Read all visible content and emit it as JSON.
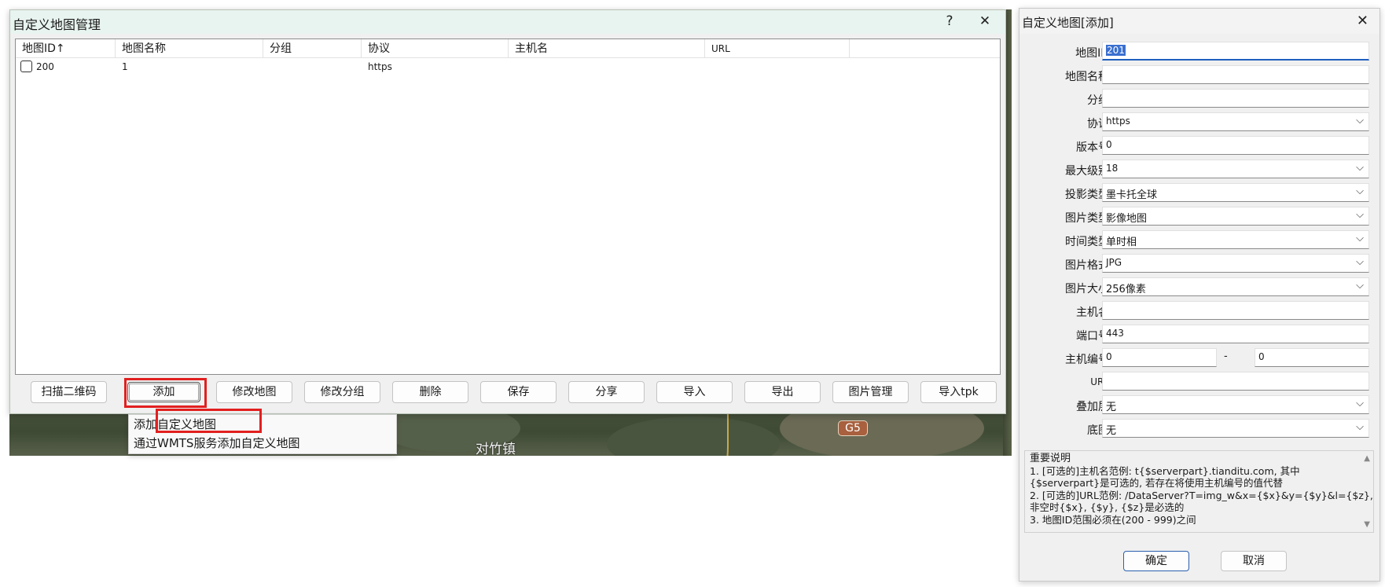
{
  "main_dialog": {
    "title": "自定义地图管理",
    "help_label": "?",
    "close_label": "✕",
    "columns": [
      "地图ID↑",
      "地图名称",
      "分组",
      "协议",
      "主机名",
      "URL"
    ],
    "rows": [
      {
        "id": "200",
        "name": "1",
        "group": "",
        "protocol": "https",
        "host": "",
        "url": ""
      }
    ],
    "buttons": {
      "scan_qr": "扫描二维码",
      "add": "添加",
      "edit_map": "修改地图",
      "edit_group": "修改分组",
      "delete": "删除",
      "save": "保存",
      "share": "分享",
      "import": "导入",
      "export": "导出",
      "image_manage": "图片管理",
      "import_tpk": "导入tpk"
    }
  },
  "add_menu": {
    "items": [
      "添加自定义地图",
      "通过WMTS服务添加自定义地图"
    ]
  },
  "map_background": {
    "labels": [
      "对竹镇",
      "G5"
    ]
  },
  "add_dialog": {
    "title": "自定义地图[添加]",
    "close_label": "✕",
    "fields": {
      "map_id": {
        "label": "地图ID",
        "value": "201"
      },
      "map_name": {
        "label": "地图名称",
        "value": ""
      },
      "group": {
        "label": "分组",
        "value": ""
      },
      "protocol": {
        "label": "协议",
        "value": "https"
      },
      "version": {
        "label": "版本号",
        "value": "0"
      },
      "max_level": {
        "label": "最大级别",
        "value": "18"
      },
      "projection": {
        "label": "投影类型",
        "value": "墨卡托全球"
      },
      "image_type": {
        "label": "图片类型",
        "value": "影像地图"
      },
      "time_type": {
        "label": "时间类型",
        "value": "单时相"
      },
      "image_format": {
        "label": "图片格式",
        "value": "JPG"
      },
      "image_size": {
        "label": "图片大小",
        "value": "256像素"
      },
      "host": {
        "label": "主机名",
        "value": ""
      },
      "port": {
        "label": "端口号",
        "value": "443"
      },
      "host_number": {
        "label": "主机编号",
        "from": "0",
        "separator": "-",
        "to": "0"
      },
      "url": {
        "label": "URL",
        "value": ""
      },
      "overlay": {
        "label": "叠加层",
        "value": "无"
      },
      "base_map": {
        "label": "底图",
        "value": "无"
      }
    },
    "notes": [
      "重要说明",
      "1. [可选的]主机名范例: t{$serverpart}.tianditu.com, 其中",
      "{$serverpart}是可选的, 若存在将使用主机编号的值代替",
      "2. [可选的]URL范例: /DataServer?T=img_w&x={$x}&y={$y}&l={$z},",
      "非空时{$x}, {$y}, {$z}是必选的",
      "3. 地图ID范围必须在(200 - 999)之间"
    ],
    "ok_label": "确定",
    "cancel_label": "取消"
  },
  "colors": {
    "title_bar": "#e8f4ef",
    "highlight_frame": "#e21f1f",
    "selection": "#3a6fd0"
  }
}
